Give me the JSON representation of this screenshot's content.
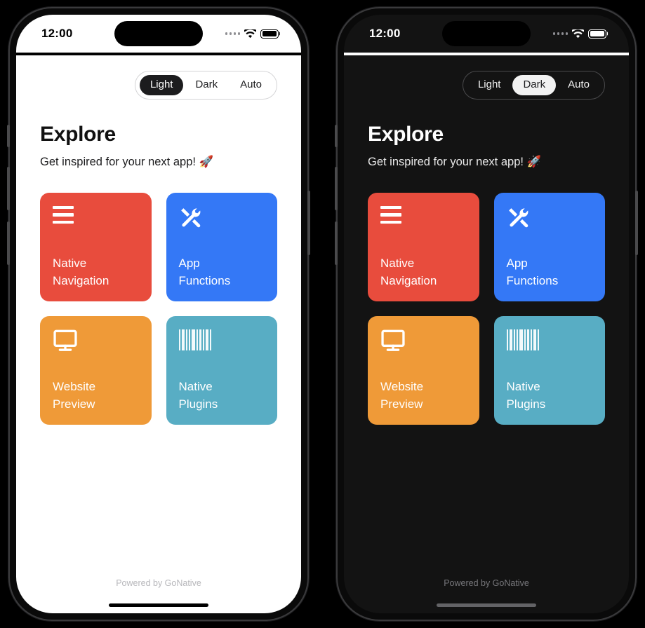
{
  "phones": [
    {
      "id": "light",
      "mode_label": "Light",
      "status_bar": {
        "time": "12:00",
        "wifi_icon": "wifi-icon",
        "battery_icon": "battery-full-icon",
        "signal_icon": "signal-dots-icon"
      },
      "theme_toggle": {
        "options": [
          "Light",
          "Dark",
          "Auto"
        ],
        "selected": "Light"
      },
      "header": {
        "title": "Explore",
        "subtitle": "Get inspired for your next app! 🚀"
      },
      "cards": [
        {
          "label": "Native\nNavigation",
          "icon": "hamburger-menu-icon",
          "color": "#E84C3D"
        },
        {
          "label": "App\nFunctions",
          "icon": "tools-icon",
          "color": "#3478F6"
        },
        {
          "label": "Website\nPreview",
          "icon": "monitor-icon",
          "color": "#EF9A38"
        },
        {
          "label": "Native\nPlugins",
          "icon": "barcode-icon",
          "color": "#58ADC4"
        }
      ],
      "footer": "Powered by GoNative"
    },
    {
      "id": "dark",
      "mode_label": "Dark",
      "status_bar": {
        "time": "12:00",
        "wifi_icon": "wifi-icon",
        "battery_icon": "battery-full-icon",
        "signal_icon": "signal-dots-icon"
      },
      "theme_toggle": {
        "options": [
          "Light",
          "Dark",
          "Auto"
        ],
        "selected": "Dark"
      },
      "header": {
        "title": "Explore",
        "subtitle": "Get inspired for your next app! 🚀"
      },
      "cards": [
        {
          "label": "Native\nNavigation",
          "icon": "hamburger-menu-icon",
          "color": "#E84C3D"
        },
        {
          "label": "App\nFunctions",
          "icon": "tools-icon",
          "color": "#3478F6"
        },
        {
          "label": "Website\nPreview",
          "icon": "monitor-icon",
          "color": "#EF9A38"
        },
        {
          "label": "Native\nPlugins",
          "icon": "barcode-icon",
          "color": "#58ADC4"
        }
      ],
      "footer": "Powered by GoNative"
    }
  ],
  "colors": {
    "red": "#E84C3D",
    "blue": "#3478F6",
    "orange": "#EF9A38",
    "teal": "#58ADC4",
    "light_bg": "#FFFFFF",
    "dark_bg": "#131313",
    "frame": "#0A0A0A"
  }
}
